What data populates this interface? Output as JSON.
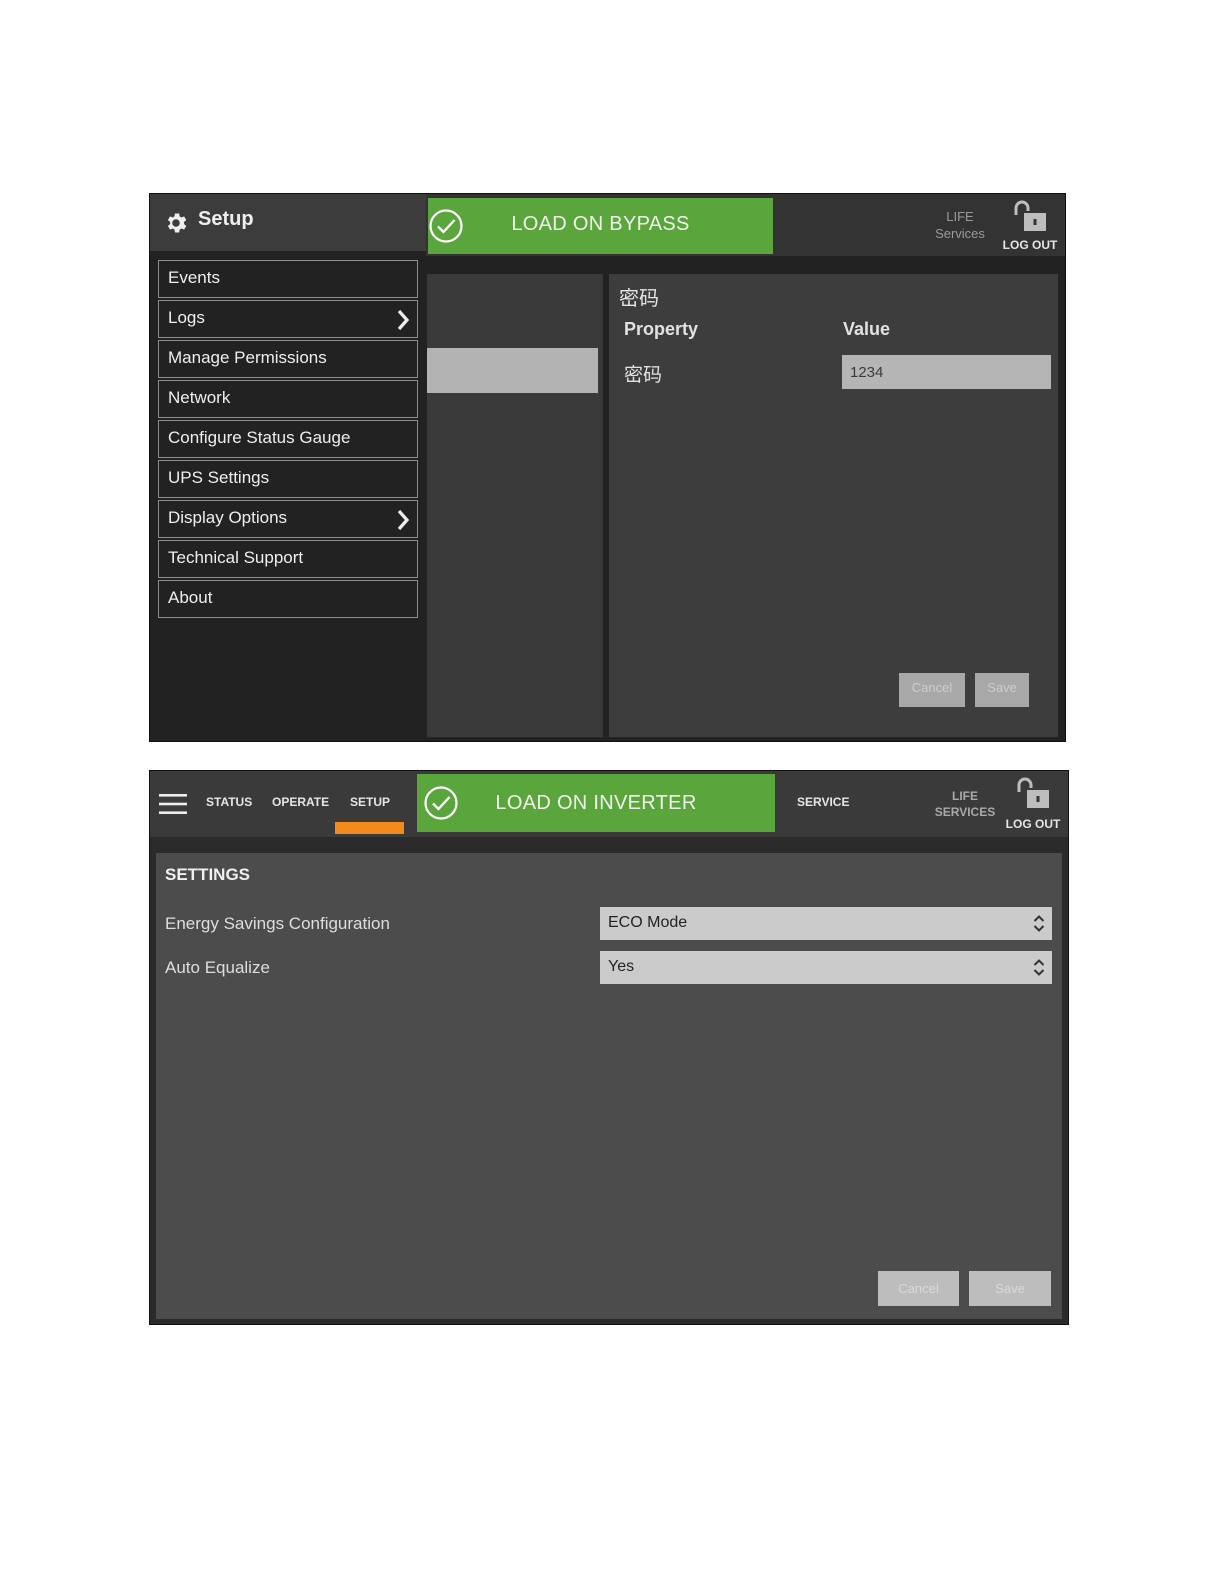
{
  "screen1": {
    "setup_title": "Setup",
    "status_banner": "LOAD ON BYPASS",
    "life_services": {
      "line1": "LIFE",
      "line2": "Services"
    },
    "logout": "LOG OUT",
    "menu": [
      {
        "label": "Events",
        "has_submenu": false
      },
      {
        "label": "Logs",
        "has_submenu": true
      },
      {
        "label": "Manage Permissions",
        "has_submenu": false
      },
      {
        "label": "Network",
        "has_submenu": false
      },
      {
        "label": "Configure Status Gauge",
        "has_submenu": false
      },
      {
        "label": "UPS Settings",
        "has_submenu": false
      },
      {
        "label": "Display Options",
        "has_submenu": true
      },
      {
        "label": "Technical Support",
        "has_submenu": false
      },
      {
        "label": "About",
        "has_submenu": false
      }
    ],
    "panel": {
      "heading": "密码",
      "col_property": "Property",
      "col_value": "Value",
      "row_property": "密码",
      "row_value": "1234",
      "cancel": "Cancel",
      "save": "Save"
    }
  },
  "screen2": {
    "tabs": {
      "status": "STATUS",
      "operate": "OPERATE",
      "setup": "SETUP",
      "service": "SERVICE"
    },
    "status_banner": "LOAD ON INVERTER",
    "life_services": {
      "line1": "LIFE",
      "line2": "SERVICES"
    },
    "logout": "LOG OUT",
    "settings_heading": "SETTINGS",
    "settings": [
      {
        "label": "Energy Savings Configuration",
        "value": "ECO Mode"
      },
      {
        "label": "Auto Equalize",
        "value": "Yes"
      }
    ],
    "cancel": "Cancel",
    "save": "Save"
  },
  "colors": {
    "status_green": "#5aa63c",
    "active_tab_orange": "#f28a1c",
    "background_dark": "#222222",
    "panel_gray": "#4c4c4c"
  },
  "icons": [
    "gear-icon",
    "check-circle-icon",
    "unlock-icon",
    "chevron-right-icon",
    "hamburger-icon",
    "select-arrows-icon"
  ]
}
